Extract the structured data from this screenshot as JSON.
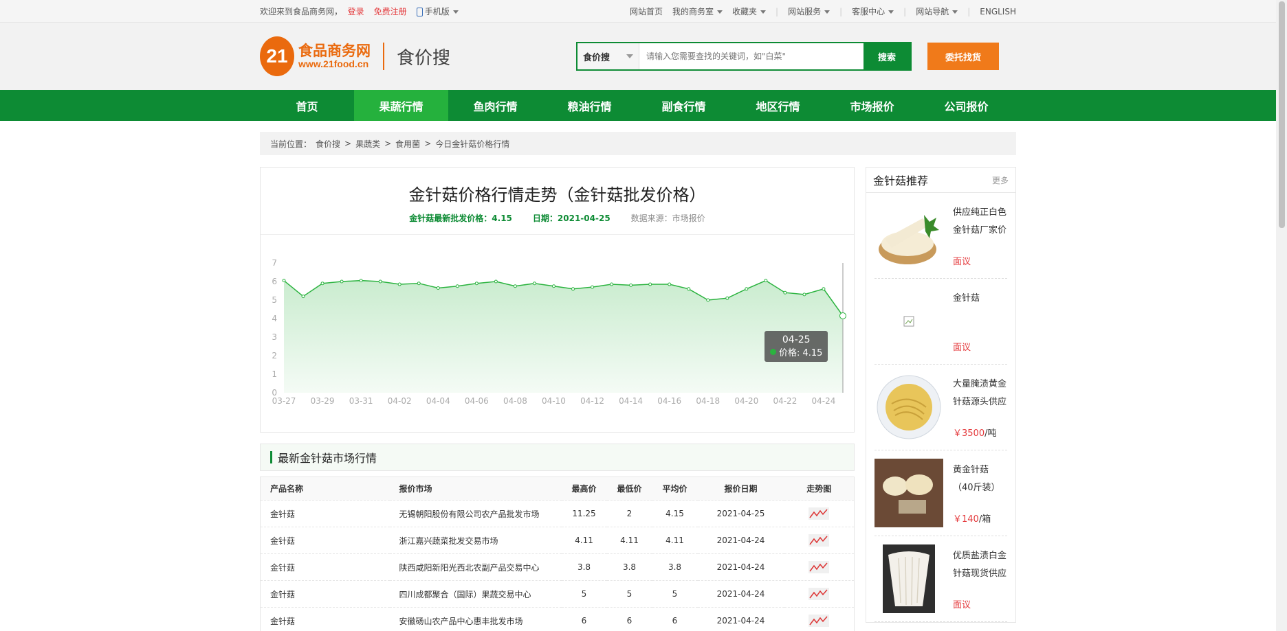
{
  "topbar": {
    "welcome": "欢迎来到食品商务网，",
    "login": "登录",
    "register": "免费注册",
    "mobile": "手机版",
    "links": [
      "网站首页",
      "我的商务室",
      "收藏夹",
      "网站服务",
      "客服中心",
      "网站导航",
      "ENGLISH"
    ]
  },
  "header": {
    "logo_number": "21",
    "logo_cn": "食品商务网",
    "logo_url": "www.21food.cn",
    "logo_sub": "食价搜",
    "search_select": "食价搜",
    "search_placeholder": "请输入您需要查找的关键词，如\"白菜\"",
    "search_button": "搜索",
    "entrust_button": "委托找货"
  },
  "nav": [
    "首页",
    "果蔬行情",
    "鱼肉行情",
    "粮油行情",
    "副食行情",
    "地区行情",
    "市场报价",
    "公司报价"
  ],
  "breadcrumb": {
    "prefix": "当前位置：",
    "items": [
      "食价搜",
      "果蔬类",
      "食用菌",
      "今日金针菇价格行情"
    ],
    "sep": ">"
  },
  "chart_box": {
    "title": "金针菇价格行情走势（金针菇批发价格）",
    "latest": "金针菇最新批发价格：4.15",
    "date": "日期：2021-04-25",
    "source": "数据来源：市场报价",
    "tooltip_date": "04-25",
    "tooltip_value": "价格: 4.15"
  },
  "chart_data": {
    "type": "line",
    "x_tick_labels": [
      "03-27",
      "03-29",
      "03-31",
      "04-02",
      "04-04",
      "04-06",
      "04-08",
      "04-10",
      "04-12",
      "04-14",
      "04-16",
      "04-18",
      "04-20",
      "04-22",
      "04-24"
    ],
    "y_tick_labels": [
      "0",
      "1",
      "2",
      "3",
      "4",
      "5",
      "6",
      "7"
    ],
    "ylim": [
      0,
      7
    ],
    "series": [
      {
        "name": "价格",
        "color": "#2bb33f",
        "values": [
          6.05,
          5.2,
          5.9,
          6.0,
          6.05,
          6.0,
          5.85,
          5.9,
          5.65,
          5.75,
          5.9,
          6.0,
          5.75,
          5.9,
          5.75,
          5.6,
          5.7,
          5.85,
          5.8,
          5.85,
          5.85,
          5.6,
          5.0,
          5.1,
          5.6,
          6.05,
          5.4,
          5.3,
          5.6,
          4.15
        ]
      }
    ],
    "grid": false
  },
  "market": {
    "section_title": "最新金针菇市场行情",
    "columns": [
      "产品名称",
      "报价市场",
      "最高价",
      "最低价",
      "平均价",
      "报价日期",
      "走势图"
    ],
    "rows": [
      [
        "金针菇",
        "无锡朝阳股份有限公司农产品批发市场",
        "11.25",
        "2",
        "4.15",
        "2021-04-25"
      ],
      [
        "金针菇",
        "浙江嘉兴蔬菜批发交易市场",
        "4.11",
        "4.11",
        "4.11",
        "2021-04-24"
      ],
      [
        "金针菇",
        "陕西咸阳新阳光西北农副产品交易中心",
        "3.8",
        "3.8",
        "3.8",
        "2021-04-24"
      ],
      [
        "金针菇",
        "四川成都聚合（国际）果蔬交易中心",
        "5",
        "5",
        "5",
        "2021-04-24"
      ],
      [
        "金针菇",
        "安徽砀山农产品中心惠丰批发市场",
        "6",
        "6",
        "6",
        "2021-04-24"
      ]
    ]
  },
  "recommend": {
    "title": "金针菇推荐",
    "more": "更多",
    "items": [
      {
        "name": "供应纯正白色金针菇厂家价",
        "price": "面议",
        "unit": ""
      },
      {
        "name": "金针菇",
        "price": "面议",
        "unit": ""
      },
      {
        "name": "大量腌渍黄金针菇源头供应",
        "price": "￥3500",
        "unit": "/吨"
      },
      {
        "name": "黄金针菇（40斤装）",
        "price": "￥140",
        "unit": "/箱"
      },
      {
        "name": "优质盐渍白金针菇现货供应",
        "price": "面议",
        "unit": ""
      }
    ]
  }
}
